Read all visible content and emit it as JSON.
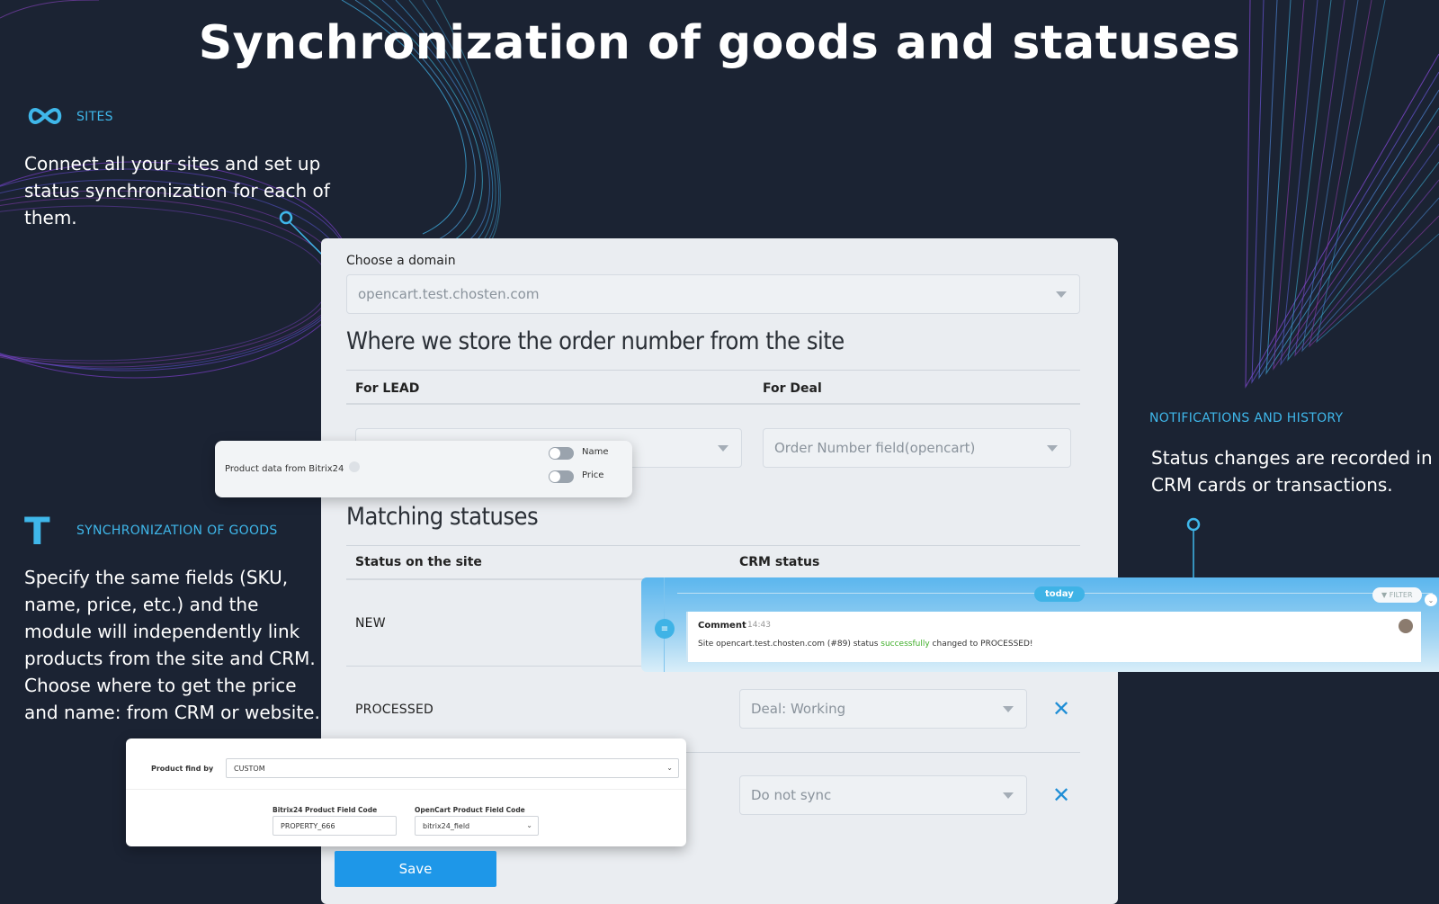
{
  "hero": {
    "title": "Synchronization of goods and statuses"
  },
  "sites": {
    "label": "SITES",
    "icon": "infinity-icon",
    "text": "Connect all your sites and set up status synchronization for each of them."
  },
  "goods": {
    "label": "SYNCHRONIZATION OF GOODS",
    "icon": "letter-t-icon",
    "text": "Specify the same fields (SKU, name, price, etc.) and the module will independently link products from the site and CRM. Choose where to get the price and name: from CRM or website."
  },
  "notifications": {
    "label": "NOTIFICATIONS AND HISTORY",
    "text": "Status changes are recorded in CRM cards or transactions."
  },
  "panel": {
    "domain_label": "Choose a domain",
    "domain_value": "opencart.test.chosten.com",
    "order_heading": "Where we store the order number from the site",
    "for_lead": "For LEAD",
    "for_deal": "For Deal",
    "deal_value": "Order Number field(opencart)",
    "matching_heading": "Matching statuses",
    "col_site": "Status on the site",
    "col_crm": "CRM status",
    "rows": [
      {
        "site": "NEW",
        "crm": ""
      },
      {
        "site": "PROCESSED",
        "crm": "Deal: Working"
      },
      {
        "site": "",
        "crm": "Do not sync"
      }
    ],
    "save_label": "Save"
  },
  "product_popup": {
    "label": "Product data from Bitrix24",
    "toggles": [
      "Name",
      "Price"
    ]
  },
  "notification_card": {
    "today": "today",
    "filter": "FILTER",
    "comment_title": "Comment",
    "comment_time": "14:43",
    "message_pre": "Site opencart.test.chosten.com (#89) status",
    "message_highlight": "successfully",
    "message_post": "changed to PROCESSED!"
  },
  "find_popup": {
    "label": "Product find by",
    "value": "CUSTOM",
    "bitrix_label": "Bitrix24 Product Field Code",
    "bitrix_value": "PROPERTY_666",
    "opencart_label": "OpenCart Product Field Code",
    "opencart_value": "bitrix24_field"
  },
  "colors": {
    "background": "#1b2333",
    "accent": "#3fb7ea",
    "save": "#1e97e8",
    "success": "#3fae29"
  }
}
